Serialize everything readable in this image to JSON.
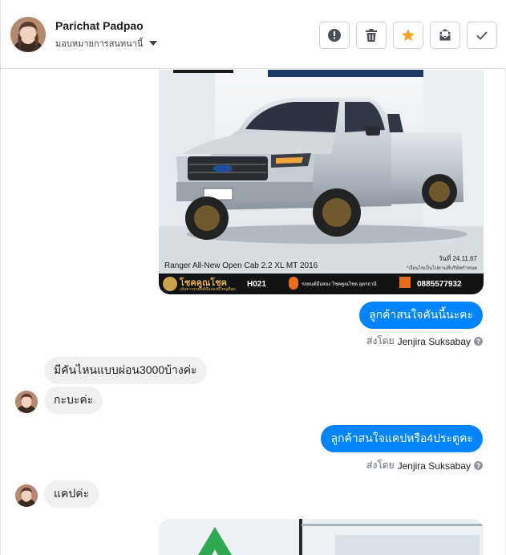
{
  "header": {
    "contact_name": "Parichat Padpao",
    "assign_label": "มอบหมายการสนทนานี้"
  },
  "actions": [
    {
      "name": "alert-icon"
    },
    {
      "name": "trash-icon"
    },
    {
      "name": "star-icon"
    },
    {
      "name": "mark-unread-icon"
    },
    {
      "name": "check-icon"
    }
  ],
  "car_ad": {
    "model_text": "Ranger All-New Open Cab 2.2 XL MT 2016",
    "date_text": "วันที่ 24.11.67",
    "price_note": "*เงื่อนไขเป็นไปตามที่บริษัทกำหนด",
    "brand": "โชคคูณโชค",
    "brand_sub": "เส้นทางรถยนต์มือสองที่ใหญ่ที่สุด",
    "code": "H021",
    "location": "รถยนต์มือสอง โชคคูณโชค อุดรธานี",
    "phone": "0885577932"
  },
  "messages": [
    {
      "direction": "out",
      "text": "ลูกค้าสนใจคันนี้นะคะ",
      "sent_by_prefix": "ส่งโดย",
      "sender": "Jenjira Suksabay"
    },
    {
      "direction": "in",
      "text": "มีคันไหนแบบผ่อน3000บ้างค่ะ"
    },
    {
      "direction": "in",
      "text": "กะบะค่ะ"
    },
    {
      "direction": "out",
      "text": "ลูกค้าสนใจแคปหรือ4ประตูคะ",
      "sent_by_prefix": "ส่งโดย",
      "sender": "Jenjira Suksabay"
    },
    {
      "direction": "in",
      "text": "แคปค่ะ"
    }
  ],
  "colors": {
    "accent": "#0084ff",
    "star": "#f5a623",
    "incoming_bubble": "#f1f0f0"
  }
}
